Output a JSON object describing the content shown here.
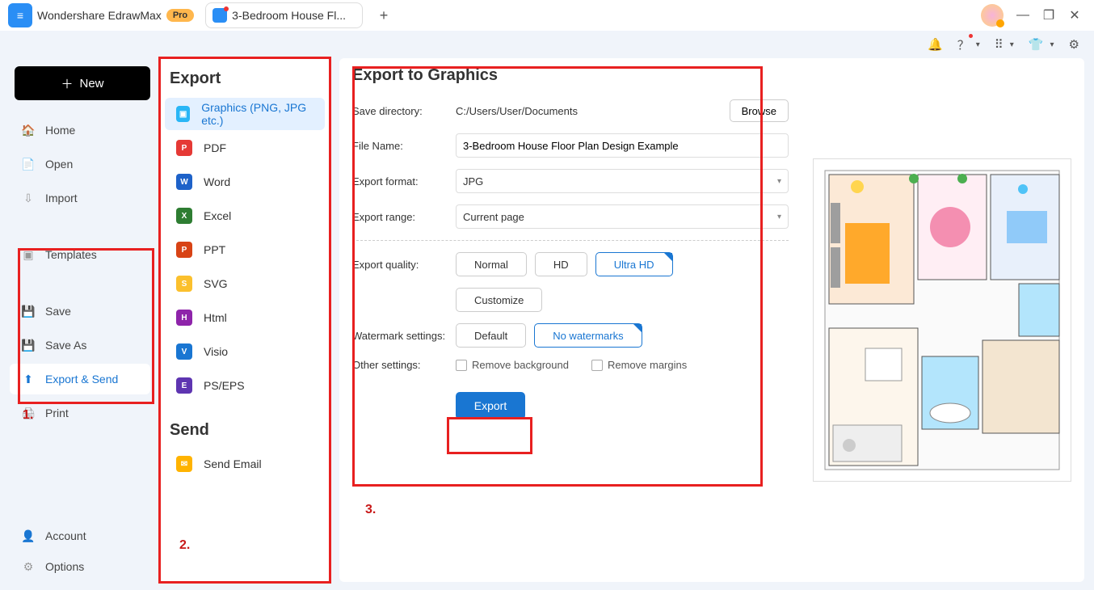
{
  "titlebar": {
    "app_name": "Wondershare EdrawMax",
    "pro": "Pro",
    "tab_label": "3-Bedroom House Fl..."
  },
  "new_button": "New",
  "nav1": [
    "Home",
    "Open",
    "Import"
  ],
  "nav_templates": "Templates",
  "nav2": [
    "Save",
    "Save As",
    "Export & Send",
    "Print"
  ],
  "nav_bottom": [
    "Account",
    "Options"
  ],
  "export_panel": {
    "title": "Export",
    "items": [
      "Graphics (PNG, JPG etc.)",
      "PDF",
      "Word",
      "Excel",
      "PPT",
      "SVG",
      "Html",
      "Visio",
      "PS/EPS"
    ],
    "send_title": "Send",
    "send_item": "Send Email"
  },
  "form": {
    "title": "Export to Graphics",
    "save_dir_label": "Save directory:",
    "save_dir": "C:/Users/User/Documents",
    "browse": "Browse",
    "file_name_label": "File Name:",
    "file_name": "3-Bedroom House Floor Plan Design Example",
    "format_label": "Export format:",
    "format": "JPG",
    "range_label": "Export range:",
    "range": "Current page",
    "quality_label": "Export quality:",
    "quality_opts": [
      "Normal",
      "HD",
      "Ultra HD"
    ],
    "quality_selected": 2,
    "customize": "Customize",
    "watermark_label": "Watermark settings:",
    "watermark_opts": [
      "Default",
      "No watermarks"
    ],
    "watermark_selected": 1,
    "other_label": "Other settings:",
    "remove_bg": "Remove background",
    "remove_margins": "Remove margins",
    "export_btn": "Export"
  },
  "annot": {
    "a1": "1.",
    "a2": "2.",
    "a3": "3."
  }
}
